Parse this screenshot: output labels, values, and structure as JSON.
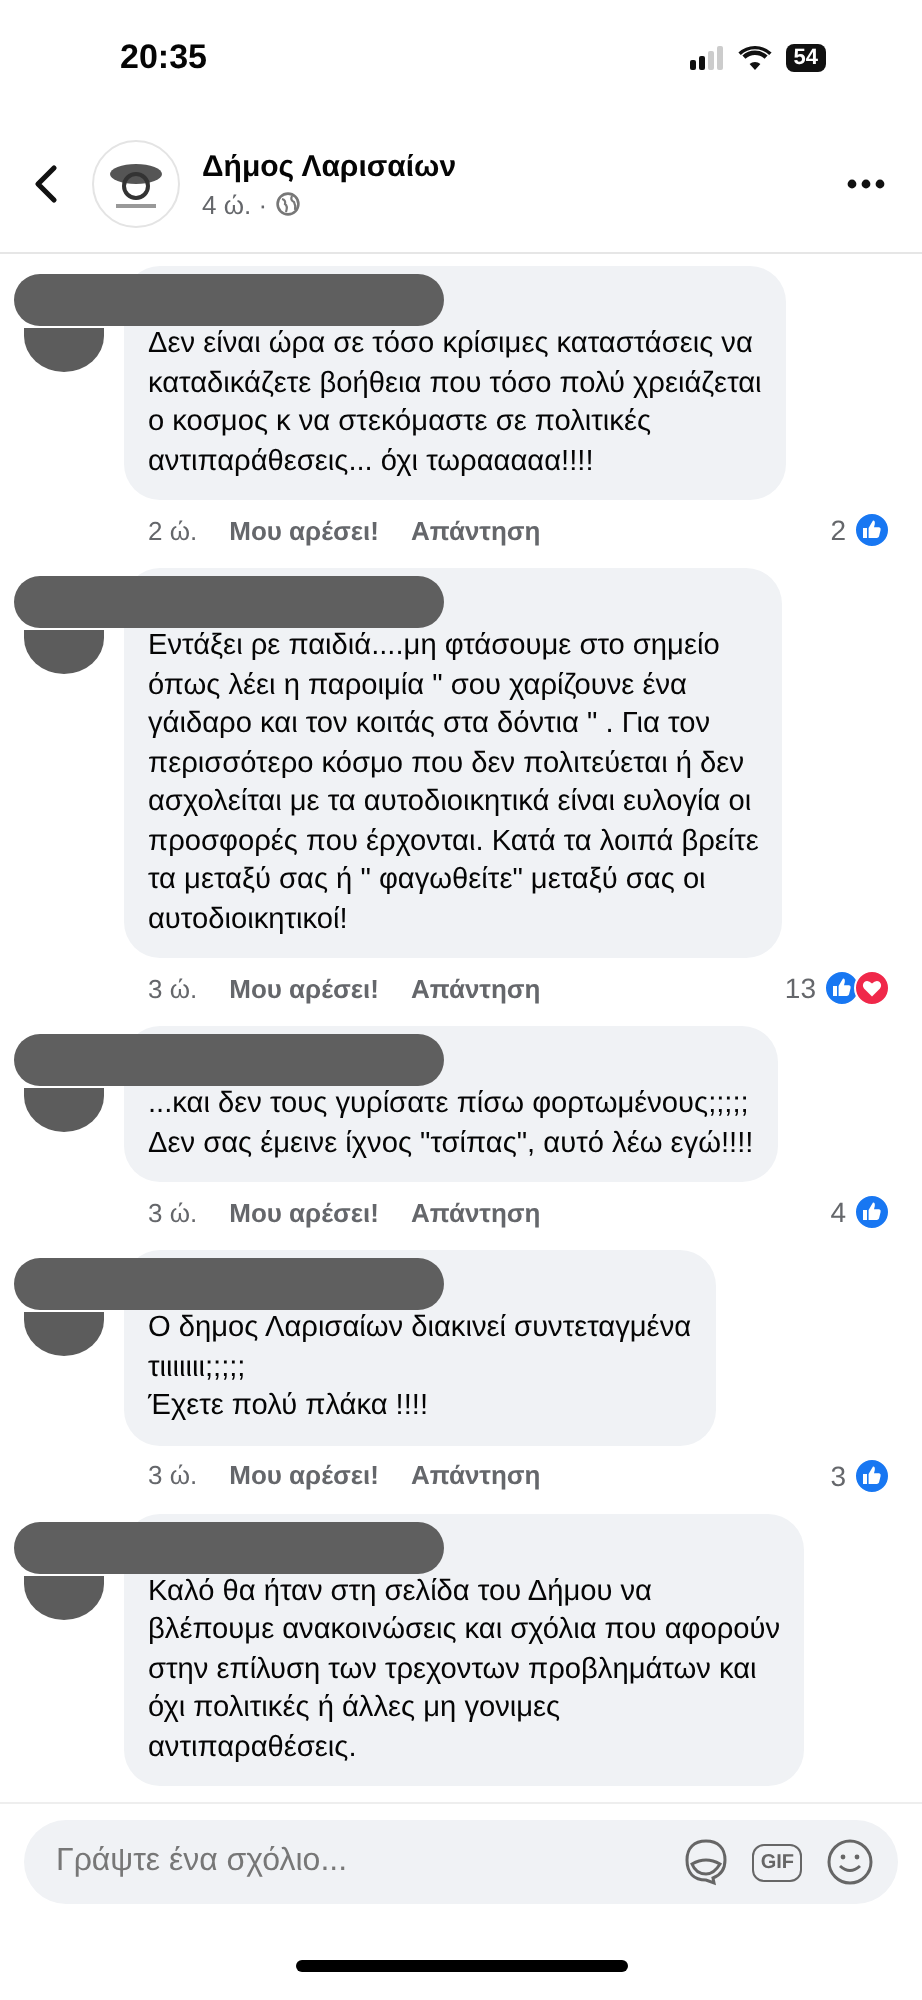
{
  "status_bar": {
    "time": "20:35",
    "battery": "54"
  },
  "post_header": {
    "page_name": "Δήμος Λαρισαίων",
    "age": "4 ώ. ·"
  },
  "comments": [
    {
      "text": "Δεν είναι ώρα σε τόσο κρίσιμες καταστάσεις να\nκαταδικάζετε βοήθεια που τόσο πολύ χρειάζεται\nο κοσμος κ να  στεκόμαστε σε πολιτικές\nαντιπαράθεσεις...  όχι τωρααααα!!!!",
      "time": "2 ώ.",
      "like_label": "Μου αρέσει!",
      "reply_label": "Απάντηση",
      "reaction_count": "2",
      "reactions": [
        {
          "kind": "like"
        }
      ]
    },
    {
      "text": "Εντάξει ρε παιδιά....μη φτάσουμε στο σημείο\nόπως λέει η παροιμία \" σου χαρίζουνε ένα\nγάιδαρο και τον κοιτάς στα δόντια \" . Για τον\nπερισσότερο κόσμο που δεν πολιτεύεται ή δεν\nασχολείται με τα αυτοδιοικητικά είναι ευλογία οι\nπροσφορές που έρχονται. Κατά τα λοιπά βρείτε\nτα μεταξύ σας ή \" φαγωθείτε\" μεταξύ σας οι\nαυτοδιοικητικοί!",
      "time": "3 ώ.",
      "like_label": "Μου αρέσει!",
      "reply_label": "Απάντηση",
      "reaction_count": "13",
      "reactions": [
        {
          "kind": "like"
        },
        {
          "kind": "love"
        }
      ]
    },
    {
      "text": "...και δεν τους γυρίσατε πίσω φορτωμένους;;;;;\nΔεν σας έμεινε ίχνος \"τσίπας\", αυτό λέω εγώ!!!!",
      "time": "3 ώ.",
      "like_label": "Μου αρέσει!",
      "reply_label": "Απάντηση",
      "reaction_count": "4",
      "reactions": [
        {
          "kind": "like"
        }
      ]
    },
    {
      "text": "Ο δημος Λαρισαίων διακινεί συντεταγμένα\nτιιιιιιι;;;;;\nΈχετε πολύ πλάκα !!!!",
      "time": "3 ώ.",
      "like_label": "Μου αρέσει!",
      "reply_label": "Απάντηση",
      "reaction_count": "3",
      "reactions": [
        {
          "kind": "like"
        }
      ]
    },
    {
      "text": "Καλό θα ήταν στη σελίδα του Δήμου να\nβλέπουμε ανακοινώσεις και σχόλια που αφορούν\nστην επίλυση των τρεχοντων προβλημάτων και\nόχι πολιτικές ή άλλες μη γονιμες\nαντιπαραθέσεις."
    }
  ],
  "composer": {
    "placeholder": "Γράψτε ένα σχόλιο...",
    "gif_label": "GIF"
  }
}
